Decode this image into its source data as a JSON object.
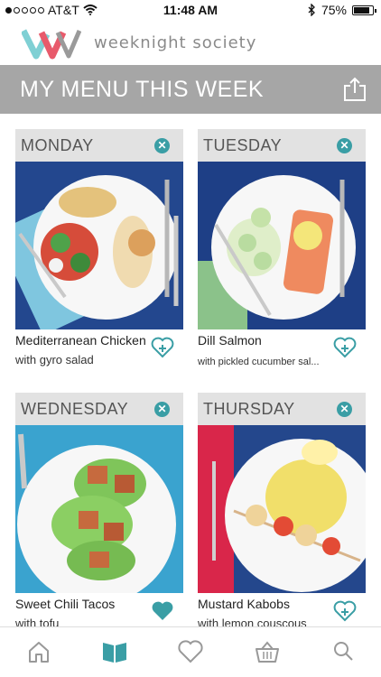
{
  "status": {
    "carrier": "AT&T",
    "time": "11:48 AM",
    "battery": "75%"
  },
  "brand": {
    "name": "weeknight society"
  },
  "banner": {
    "title": "MY MENU THIS WEEK"
  },
  "colors": {
    "accent": "#3a9ea5",
    "banner": "#a6a6a6",
    "header": "#e2e2e2"
  },
  "menu": [
    {
      "day": "MONDAY",
      "meal": "Mediterranean Chicken",
      "sub": "with gyro salad",
      "favorited": false
    },
    {
      "day": "TUESDAY",
      "meal": "Dill Salmon",
      "sub": "with pickled cucumber sal...",
      "favorited": false
    },
    {
      "day": "WEDNESDAY",
      "meal": "Sweet Chili Tacos",
      "sub": "with tofu",
      "favorited": true
    },
    {
      "day": "THURSDAY",
      "meal": "Mustard Kabobs",
      "sub": "with lemon couscous",
      "favorited": false
    }
  ],
  "tabs": [
    {
      "name": "home-icon",
      "active": false
    },
    {
      "name": "book-icon",
      "active": true
    },
    {
      "name": "heart-icon",
      "active": false
    },
    {
      "name": "basket-icon",
      "active": false
    },
    {
      "name": "search-icon",
      "active": false
    }
  ]
}
